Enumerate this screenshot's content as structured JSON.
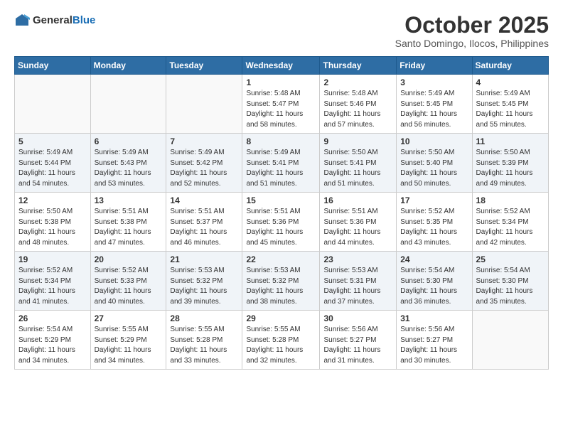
{
  "logo": {
    "general": "General",
    "blue": "Blue"
  },
  "header": {
    "month": "October 2025",
    "location": "Santo Domingo, Ilocos, Philippines"
  },
  "days_of_week": [
    "Sunday",
    "Monday",
    "Tuesday",
    "Wednesday",
    "Thursday",
    "Friday",
    "Saturday"
  ],
  "weeks": [
    [
      {
        "day": "",
        "info": ""
      },
      {
        "day": "",
        "info": ""
      },
      {
        "day": "",
        "info": ""
      },
      {
        "day": "1",
        "info": "Sunrise: 5:48 AM\nSunset: 5:47 PM\nDaylight: 11 hours\nand 58 minutes."
      },
      {
        "day": "2",
        "info": "Sunrise: 5:48 AM\nSunset: 5:46 PM\nDaylight: 11 hours\nand 57 minutes."
      },
      {
        "day": "3",
        "info": "Sunrise: 5:49 AM\nSunset: 5:45 PM\nDaylight: 11 hours\nand 56 minutes."
      },
      {
        "day": "4",
        "info": "Sunrise: 5:49 AM\nSunset: 5:45 PM\nDaylight: 11 hours\nand 55 minutes."
      }
    ],
    [
      {
        "day": "5",
        "info": "Sunrise: 5:49 AM\nSunset: 5:44 PM\nDaylight: 11 hours\nand 54 minutes."
      },
      {
        "day": "6",
        "info": "Sunrise: 5:49 AM\nSunset: 5:43 PM\nDaylight: 11 hours\nand 53 minutes."
      },
      {
        "day": "7",
        "info": "Sunrise: 5:49 AM\nSunset: 5:42 PM\nDaylight: 11 hours\nand 52 minutes."
      },
      {
        "day": "8",
        "info": "Sunrise: 5:49 AM\nSunset: 5:41 PM\nDaylight: 11 hours\nand 51 minutes."
      },
      {
        "day": "9",
        "info": "Sunrise: 5:50 AM\nSunset: 5:41 PM\nDaylight: 11 hours\nand 51 minutes."
      },
      {
        "day": "10",
        "info": "Sunrise: 5:50 AM\nSunset: 5:40 PM\nDaylight: 11 hours\nand 50 minutes."
      },
      {
        "day": "11",
        "info": "Sunrise: 5:50 AM\nSunset: 5:39 PM\nDaylight: 11 hours\nand 49 minutes."
      }
    ],
    [
      {
        "day": "12",
        "info": "Sunrise: 5:50 AM\nSunset: 5:38 PM\nDaylight: 11 hours\nand 48 minutes."
      },
      {
        "day": "13",
        "info": "Sunrise: 5:51 AM\nSunset: 5:38 PM\nDaylight: 11 hours\nand 47 minutes."
      },
      {
        "day": "14",
        "info": "Sunrise: 5:51 AM\nSunset: 5:37 PM\nDaylight: 11 hours\nand 46 minutes."
      },
      {
        "day": "15",
        "info": "Sunrise: 5:51 AM\nSunset: 5:36 PM\nDaylight: 11 hours\nand 45 minutes."
      },
      {
        "day": "16",
        "info": "Sunrise: 5:51 AM\nSunset: 5:36 PM\nDaylight: 11 hours\nand 44 minutes."
      },
      {
        "day": "17",
        "info": "Sunrise: 5:52 AM\nSunset: 5:35 PM\nDaylight: 11 hours\nand 43 minutes."
      },
      {
        "day": "18",
        "info": "Sunrise: 5:52 AM\nSunset: 5:34 PM\nDaylight: 11 hours\nand 42 minutes."
      }
    ],
    [
      {
        "day": "19",
        "info": "Sunrise: 5:52 AM\nSunset: 5:34 PM\nDaylight: 11 hours\nand 41 minutes."
      },
      {
        "day": "20",
        "info": "Sunrise: 5:52 AM\nSunset: 5:33 PM\nDaylight: 11 hours\nand 40 minutes."
      },
      {
        "day": "21",
        "info": "Sunrise: 5:53 AM\nSunset: 5:32 PM\nDaylight: 11 hours\nand 39 minutes."
      },
      {
        "day": "22",
        "info": "Sunrise: 5:53 AM\nSunset: 5:32 PM\nDaylight: 11 hours\nand 38 minutes."
      },
      {
        "day": "23",
        "info": "Sunrise: 5:53 AM\nSunset: 5:31 PM\nDaylight: 11 hours\nand 37 minutes."
      },
      {
        "day": "24",
        "info": "Sunrise: 5:54 AM\nSunset: 5:30 PM\nDaylight: 11 hours\nand 36 minutes."
      },
      {
        "day": "25",
        "info": "Sunrise: 5:54 AM\nSunset: 5:30 PM\nDaylight: 11 hours\nand 35 minutes."
      }
    ],
    [
      {
        "day": "26",
        "info": "Sunrise: 5:54 AM\nSunset: 5:29 PM\nDaylight: 11 hours\nand 34 minutes."
      },
      {
        "day": "27",
        "info": "Sunrise: 5:55 AM\nSunset: 5:29 PM\nDaylight: 11 hours\nand 34 minutes."
      },
      {
        "day": "28",
        "info": "Sunrise: 5:55 AM\nSunset: 5:28 PM\nDaylight: 11 hours\nand 33 minutes."
      },
      {
        "day": "29",
        "info": "Sunrise: 5:55 AM\nSunset: 5:28 PM\nDaylight: 11 hours\nand 32 minutes."
      },
      {
        "day": "30",
        "info": "Sunrise: 5:56 AM\nSunset: 5:27 PM\nDaylight: 11 hours\nand 31 minutes."
      },
      {
        "day": "31",
        "info": "Sunrise: 5:56 AM\nSunset: 5:27 PM\nDaylight: 11 hours\nand 30 minutes."
      },
      {
        "day": "",
        "info": ""
      }
    ]
  ]
}
